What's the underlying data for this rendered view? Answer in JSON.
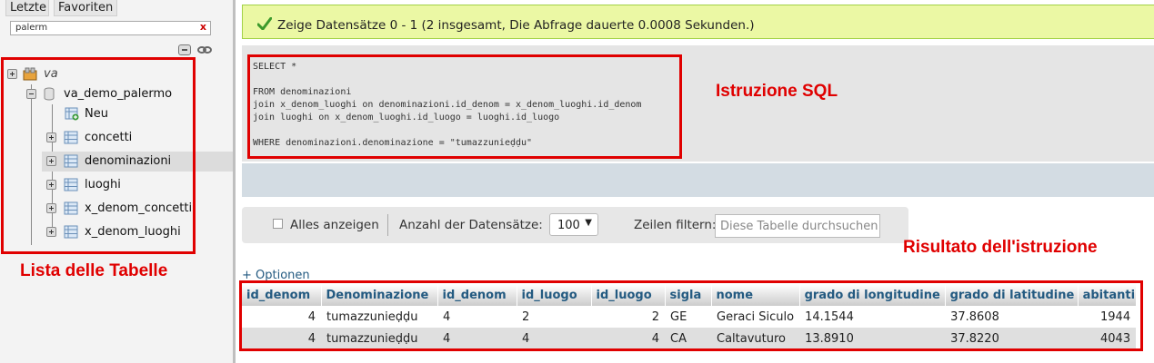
{
  "nav": {
    "tabs": [
      "Letzte",
      "Favoriten"
    ],
    "filter_value": "palerm",
    "filter_clear": "x",
    "tree": {
      "db_group": "va",
      "database": "va_demo_palermo",
      "new_label": "Neu",
      "tables": [
        "concetti",
        "denominazioni",
        "luoghi",
        "x_denom_concetti",
        "x_denom_luoghi"
      ],
      "selected_table": "denominazioni"
    }
  },
  "message": {
    "text": "Zeige Datensätze 0 - 1 (2 insgesamt, Die Abfrage dauerte 0.0008 Sekunden.)",
    "color": "#ebf8a4"
  },
  "sql": {
    "lines": [
      "SELECT *",
      "",
      "FROM denominazioni",
      "join x_denom_luoghi on denominazioni.id_denom = x_denom_luoghi.id_denom",
      "join luoghi on x_denom_luoghi.id_luogo = luoghi.id_luogo",
      "",
      "WHERE denominazioni.denominazione = \"tumazzunieḍḍu\""
    ]
  },
  "toolbar": {
    "show_all_label": "Alles anzeigen",
    "row_count_label": "Anzahl der Datensätze:",
    "row_count_value": "100",
    "filter_label": "Zeilen filtern:",
    "filter_placeholder": "Diese Tabelle durchsuchen"
  },
  "options_link": "+ Optionen",
  "result": {
    "columns": [
      "id_denom",
      "Denominazione",
      "id_denom",
      "id_luogo",
      "id_luogo",
      "sigla",
      "nome",
      "grado di longitudine",
      "grado di latitudine",
      "abitanti"
    ],
    "rows": [
      [
        "4",
        "tumazzunieḍḍu",
        "4",
        "2",
        "2",
        "GE",
        "Geraci Siculo",
        "14.1544",
        "37.8608",
        "1944"
      ],
      [
        "4",
        "tumazzunieḍḍu",
        "4",
        "4",
        "4",
        "CA",
        "Caltavuturo",
        "13.8910",
        "37.8220",
        "4043"
      ]
    ]
  },
  "annotations": {
    "tables_list": "Lista delle Tabelle",
    "sql_statement": "Istruzione SQL",
    "statement_result": "Risultato dell'istruzione",
    "color": "#e00000"
  }
}
